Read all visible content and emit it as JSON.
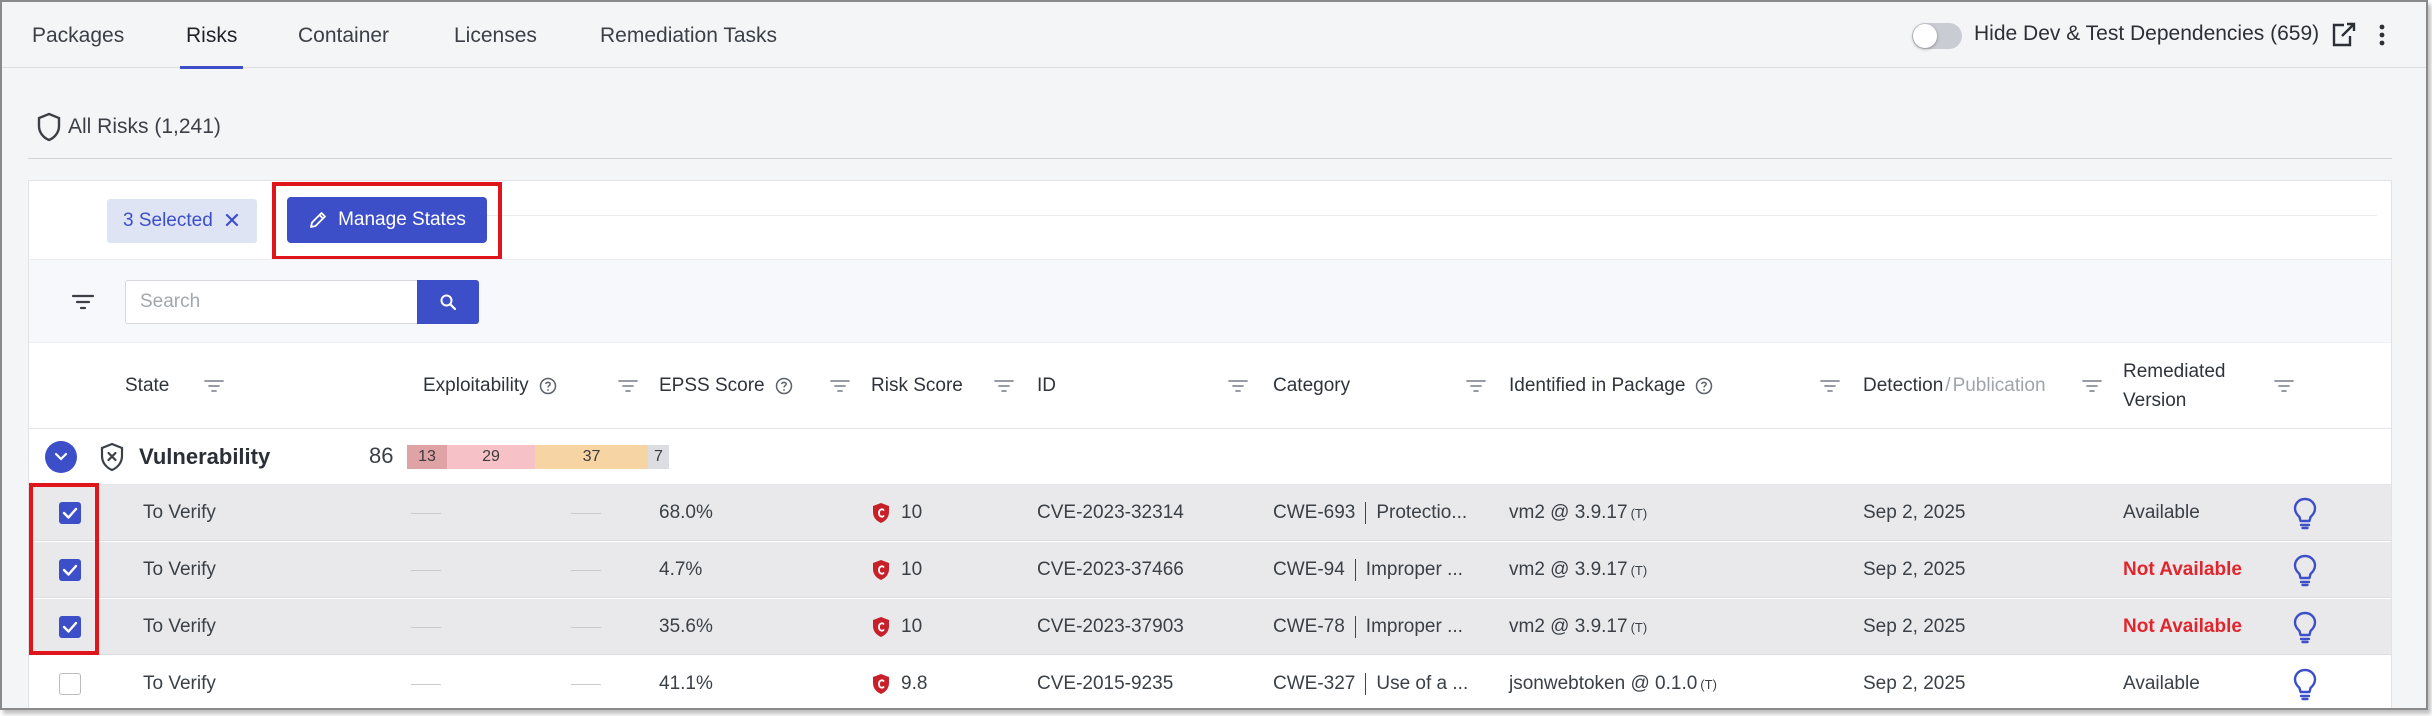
{
  "tabs": [
    {
      "label": "Packages",
      "active": false
    },
    {
      "label": "Risks",
      "active": true
    },
    {
      "label": "Container",
      "active": false
    },
    {
      "label": "Licenses",
      "active": false
    },
    {
      "label": "Remediation Tasks",
      "active": false
    }
  ],
  "toolbar": {
    "hide_dev_label": "Hide Dev & Test Dependencies (659)",
    "hide_dev_enabled": false
  },
  "section": {
    "title": "All Risks (1,241)"
  },
  "selection": {
    "chip_label": "3 Selected",
    "manage_label": "Manage States"
  },
  "search": {
    "placeholder": "Search",
    "value": ""
  },
  "columns": {
    "state": "State",
    "exploitability": "Exploitability",
    "epss": "EPSS Score",
    "risk": "Risk Score",
    "id": "ID",
    "category": "Category",
    "package": "Identified in Package",
    "detection": "Detection",
    "publication": "Publication",
    "remediated_line1": "Remediated",
    "remediated_line2": "Version"
  },
  "group": {
    "title": "Vulnerability",
    "count": "86",
    "severity": [
      {
        "label": "13",
        "value": 13,
        "color": "#e0a3a5"
      },
      {
        "label": "29",
        "value": 29,
        "color": "#f6c2c8"
      },
      {
        "label": "37",
        "value": 37,
        "color": "#f7d4a3"
      },
      {
        "label": "7",
        "value": 7,
        "color": "#dcdde2"
      }
    ]
  },
  "rows": [
    {
      "selected": true,
      "state": "To Verify",
      "epss": "68.0%",
      "risk": "10",
      "id": "CVE-2023-32314",
      "cwe": "CWE-693",
      "cat": "Protectio...",
      "pkg": "vm2 @ 3.9.17",
      "pkg_tag": "(T)",
      "detection": "Sep 2, 2025",
      "remediated": "Available",
      "remediated_available": true
    },
    {
      "selected": true,
      "state": "To Verify",
      "epss": "4.7%",
      "risk": "10",
      "id": "CVE-2023-37466",
      "cwe": "CWE-94",
      "cat": "Improper ...",
      "pkg": "vm2 @ 3.9.17",
      "pkg_tag": "(T)",
      "detection": "Sep 2, 2025",
      "remediated": "Not Available",
      "remediated_available": false
    },
    {
      "selected": true,
      "state": "To Verify",
      "epss": "35.6%",
      "risk": "10",
      "id": "CVE-2023-37903",
      "cwe": "CWE-78",
      "cat": "Improper ...",
      "pkg": "vm2 @ 3.9.17",
      "pkg_tag": "(T)",
      "detection": "Sep 2, 2025",
      "remediated": "Not Available",
      "remediated_available": false
    },
    {
      "selected": false,
      "state": "To Verify",
      "epss": "41.1%",
      "risk": "9.8",
      "id": "CVE-2015-9235",
      "cwe": "CWE-327",
      "cat": "Use of a ...",
      "pkg": "jsonwebtoken @ 0.1.0",
      "pkg_tag": "(T)",
      "detection": "Sep 2, 2025",
      "remediated": "Available",
      "remediated_available": true
    }
  ],
  "colors": {
    "accent": "#3c4fc8",
    "highlight": "#e0151c",
    "not_available": "#e0262d",
    "risk_badge": "#c8202a"
  }
}
